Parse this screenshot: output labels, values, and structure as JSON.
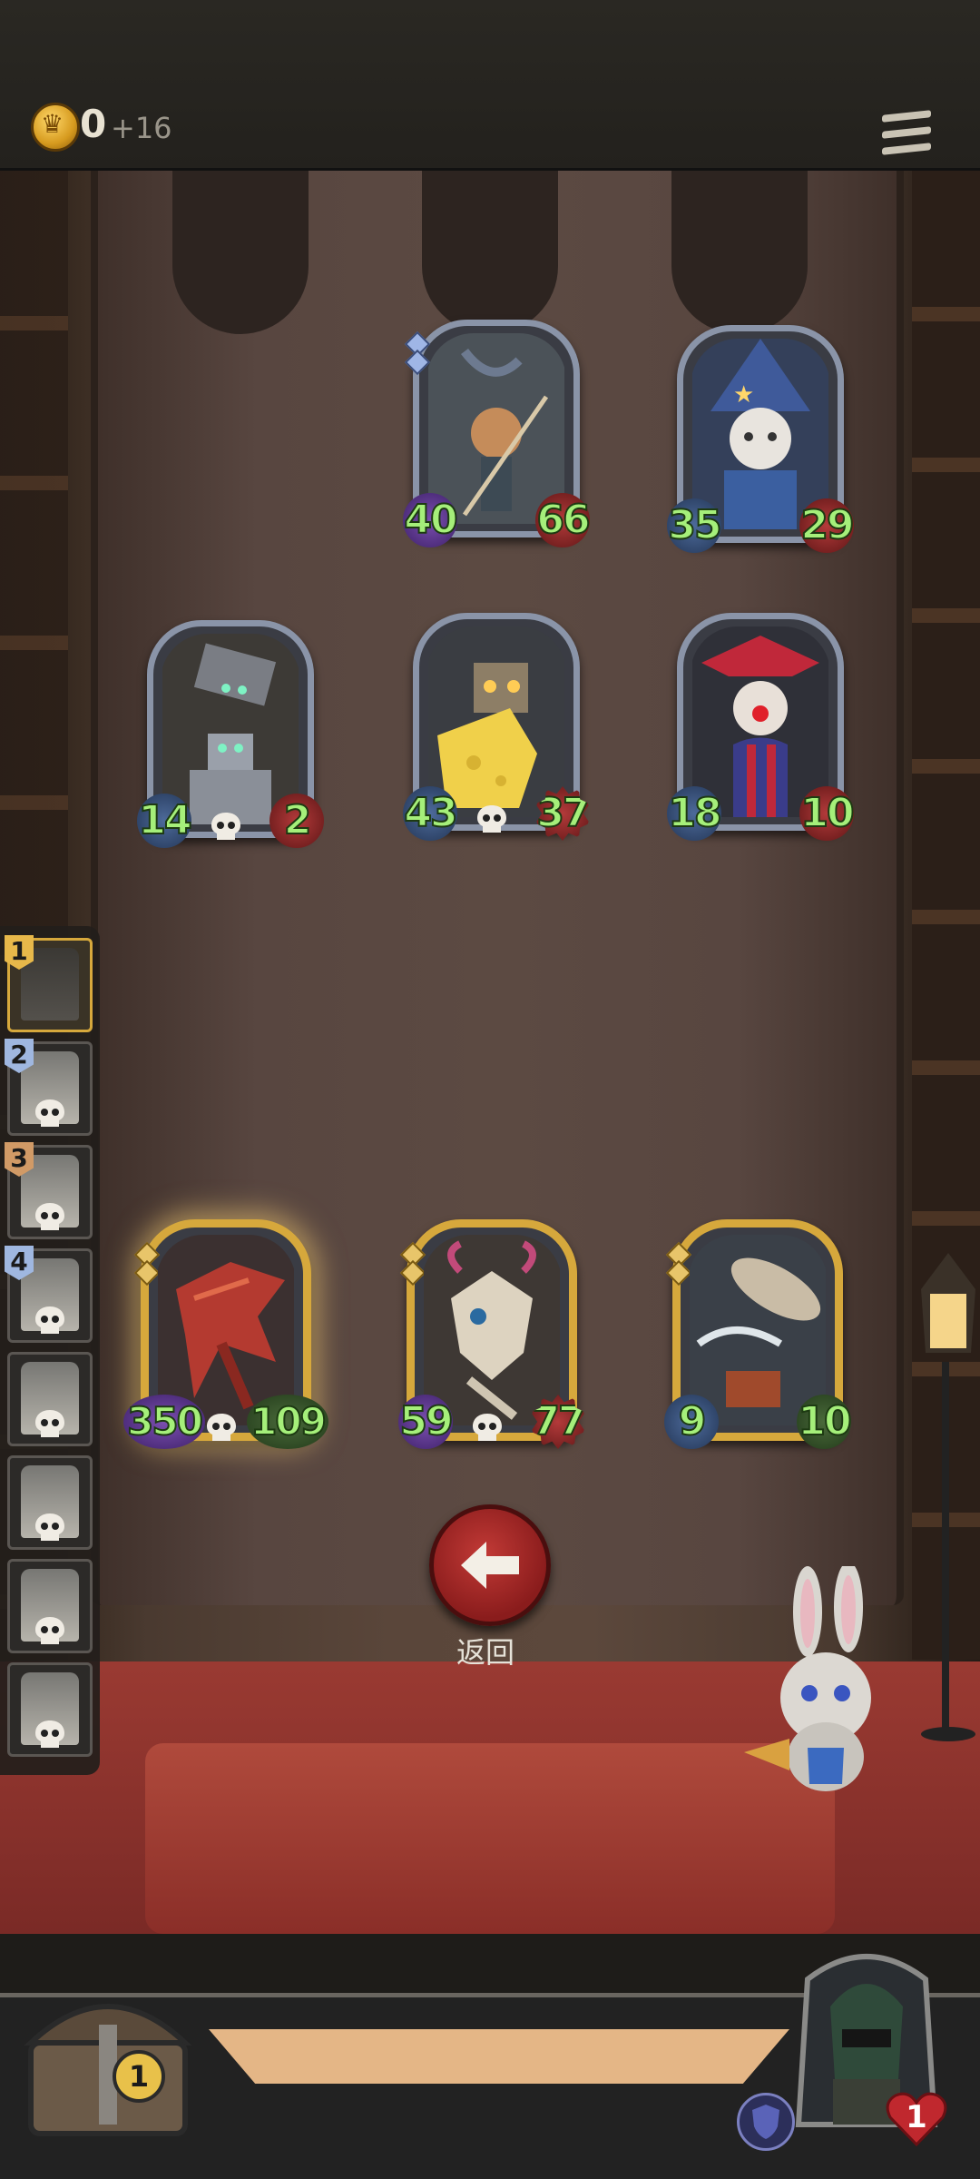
{
  "hud": {
    "gold": "0",
    "income": "+16"
  },
  "board": {
    "enemy_row1": [
      {
        "attack": "40",
        "health": "66"
      },
      {
        "attack": "35",
        "health": "29"
      }
    ],
    "enemy_row2": [
      {
        "attack": "14",
        "health": "2"
      },
      {
        "attack": "43",
        "health": "37"
      },
      {
        "attack": "18",
        "health": "10"
      }
    ],
    "player_row": [
      {
        "attack": "350",
        "health": "109"
      },
      {
        "attack": "59",
        "health": "77"
      },
      {
        "attack": "9",
        "health": "10"
      }
    ]
  },
  "roster": {
    "ranks": [
      "1",
      "2",
      "3",
      "4"
    ]
  },
  "back_button": {
    "label": "返回"
  },
  "chest": {
    "count": "1"
  },
  "player": {
    "lives": "1"
  },
  "colors": {
    "stat_text": "#a5ef7a",
    "gold_border": "#d6a83c",
    "silver_border": "#8a94a8",
    "back_button": "#b52c2a"
  }
}
